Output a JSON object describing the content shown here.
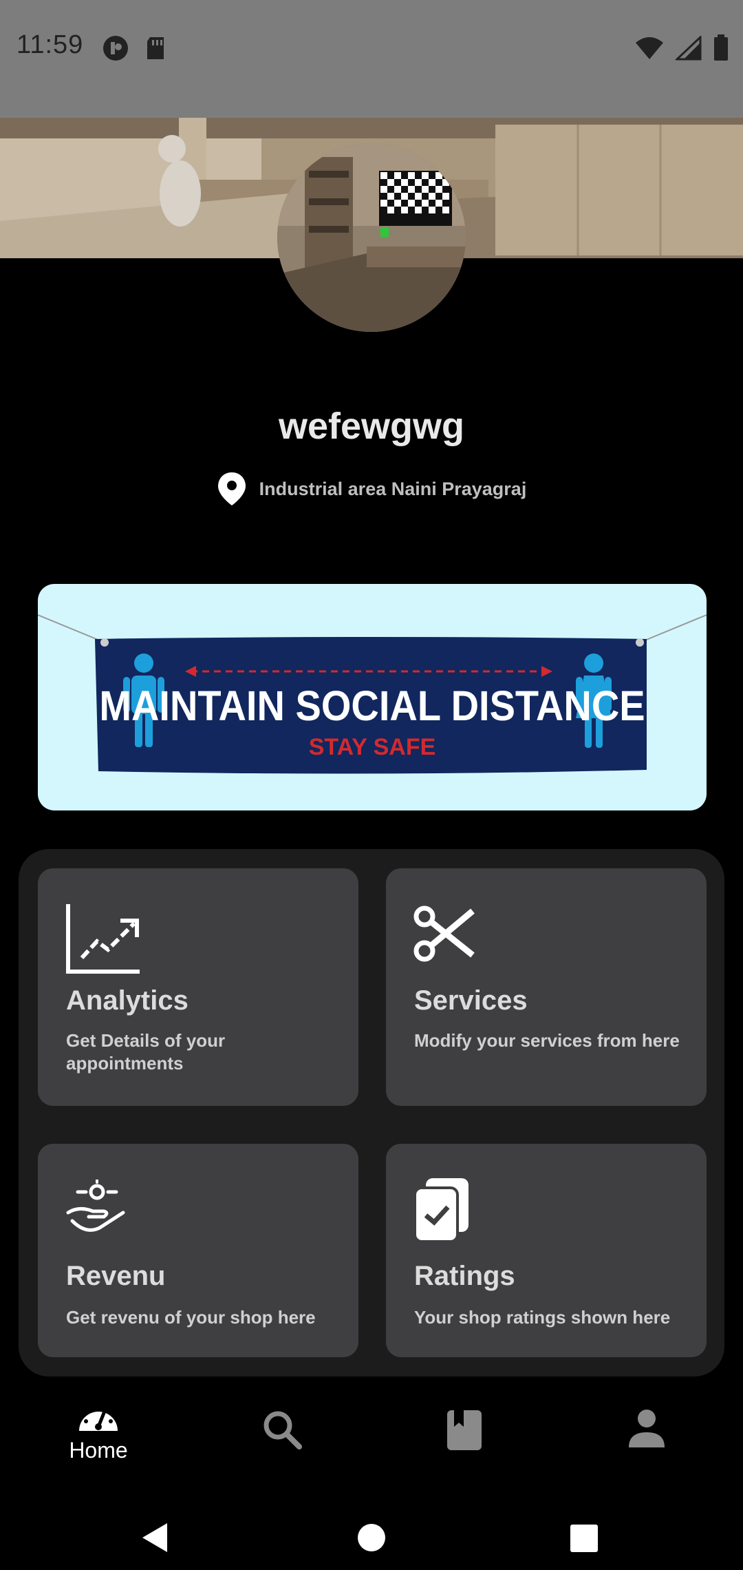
{
  "status_bar": {
    "time": "11:59",
    "icons_left": [
      "media-icon",
      "sd-card-icon"
    ],
    "icons_right": [
      "wifi-icon",
      "signal-icon",
      "battery-icon"
    ]
  },
  "profile": {
    "shop_name": "wefewgwg",
    "location": "Industrial area Naini Prayagraj"
  },
  "banner": {
    "title": "MAINTAIN SOCIAL DISTANCE",
    "subtitle": "STAY SAFE",
    "colors": {
      "background": "#d4f7fd",
      "cloth": "#11275e",
      "figures": "#1d9fdc",
      "accent": "#d22a2f"
    }
  },
  "cards": [
    {
      "title": "Analytics",
      "description": "Get Details of your appointments",
      "icon": "chart-line-icon"
    },
    {
      "title": "Services",
      "description": "Modify your services from here",
      "icon": "scissors-icon"
    },
    {
      "title": "Revenu",
      "description": "Get revenu of your shop here",
      "icon": "revenue-hand-icon"
    },
    {
      "title": "Ratings",
      "description": "Your shop ratings shown here",
      "icon": "ratings-icon"
    }
  ],
  "bottom_nav": {
    "items": [
      {
        "label": "Home",
        "icon": "speedometer-icon",
        "active": true
      },
      {
        "label": "",
        "icon": "search-icon",
        "active": false
      },
      {
        "label": "",
        "icon": "bookmark-icon",
        "active": false
      },
      {
        "label": "",
        "icon": "person-icon",
        "active": false
      }
    ]
  },
  "system_nav": {
    "icons": [
      "back-icon",
      "home-icon",
      "recents-icon"
    ]
  }
}
